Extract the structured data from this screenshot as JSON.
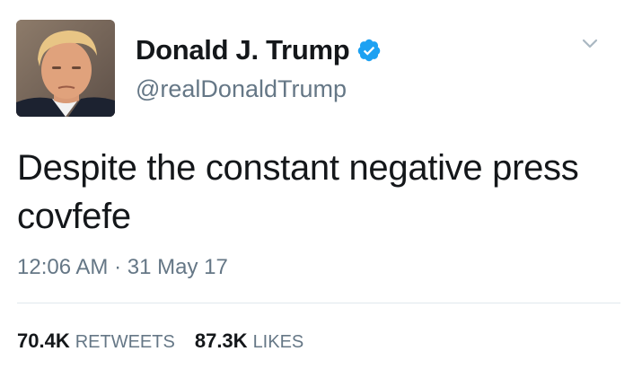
{
  "author": {
    "display_name": "Donald J. Trump",
    "handle": "@realDonaldTrump",
    "verified": true,
    "verified_color": "#1da1f2"
  },
  "tweet": {
    "text": "Despite the constant negative press covfefe",
    "time": "12:06 AM",
    "separator": "·",
    "date": "31 May 17"
  },
  "stats": {
    "retweets_count": "70.4K",
    "retweets_label": "RETWEETS",
    "likes_count": "87.3K",
    "likes_label": "LIKES"
  },
  "icons": {
    "verified": "verified-badge-icon",
    "menu": "chevron-down-icon"
  }
}
